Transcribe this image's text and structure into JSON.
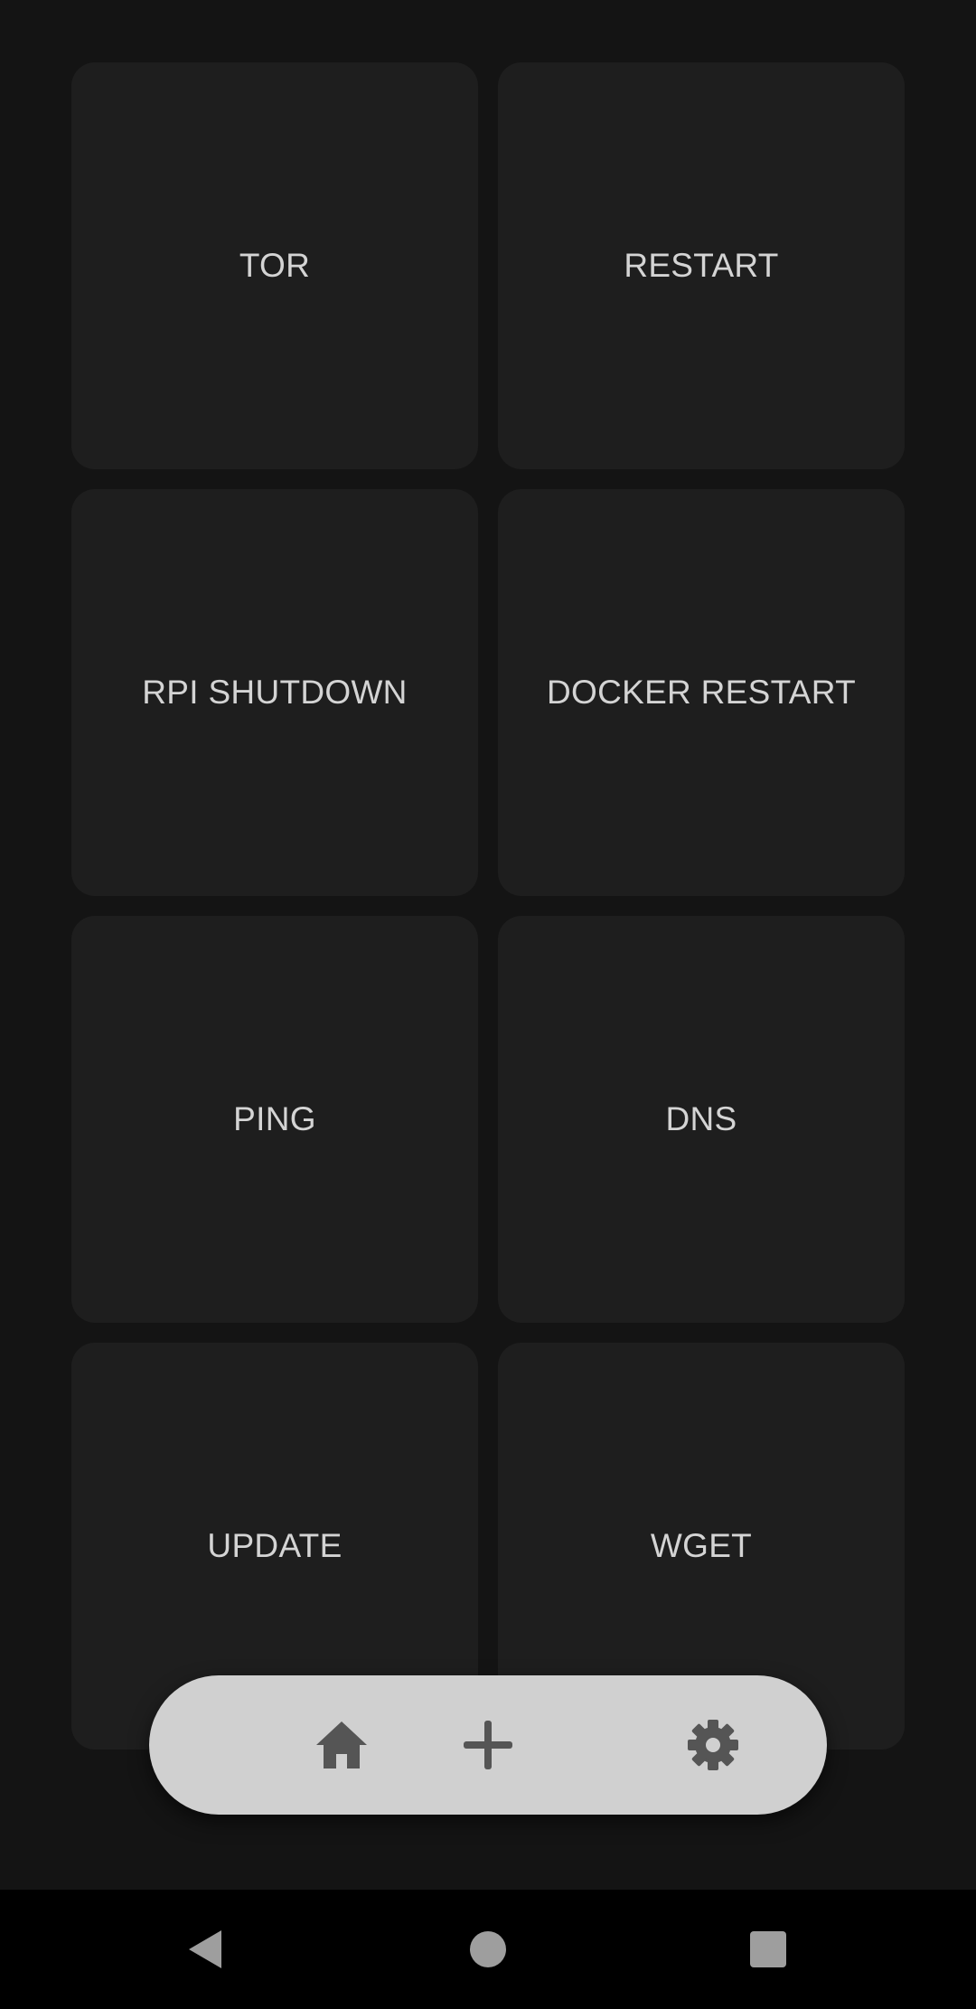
{
  "tiles": [
    {
      "label": "TOR"
    },
    {
      "label": "RESTART"
    },
    {
      "label": "RPI SHUTDOWN"
    },
    {
      "label": "DOCKER RESTART"
    },
    {
      "label": "PING"
    },
    {
      "label": "DNS"
    },
    {
      "label": "UPDATE"
    },
    {
      "label": "WGET"
    }
  ],
  "bottom_bar": {
    "items": [
      {
        "icon": "home-icon"
      },
      {
        "icon": "plus-icon"
      },
      {
        "icon": "gear-icon"
      }
    ]
  },
  "system_nav": {
    "items": [
      {
        "icon": "back-icon"
      },
      {
        "icon": "home-circle-icon"
      },
      {
        "icon": "recents-icon"
      }
    ]
  },
  "colors": {
    "background": "#141414",
    "tile": "#1e1e1e",
    "tile_text": "#d4d4d4",
    "bar": "#d0d0d0",
    "bar_icon": "#555555",
    "nav_background": "#000000",
    "nav_icon": "#9e9e9e"
  }
}
